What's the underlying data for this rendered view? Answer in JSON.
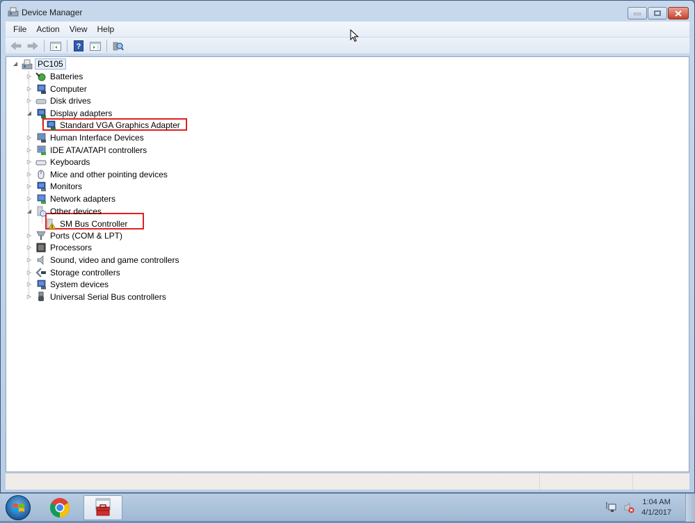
{
  "window": {
    "title": "Device Manager",
    "controls": [
      "minimize",
      "maximize",
      "close"
    ]
  },
  "menu": {
    "items": [
      {
        "label": "File"
      },
      {
        "label": "Action"
      },
      {
        "label": "View"
      },
      {
        "label": "Help"
      }
    ]
  },
  "toolbar": {
    "buttons": [
      {
        "icon": "back-arrow-icon",
        "enabled": false
      },
      {
        "icon": "forward-arrow-icon",
        "enabled": false
      },
      {
        "icon": "show-hide-console-tree-icon"
      },
      {
        "icon": "help-icon"
      },
      {
        "icon": "show-hide-action-pane-icon"
      },
      {
        "icon": "scan-hardware-changes-icon"
      }
    ]
  },
  "tree": {
    "root": {
      "label": "PC105",
      "expanded": true,
      "icon": "computer-icon"
    },
    "categories": [
      {
        "label": "Batteries",
        "expanded": false,
        "icon": "battery-icon"
      },
      {
        "label": "Computer",
        "expanded": false,
        "icon": "computer-icon"
      },
      {
        "label": "Disk drives",
        "expanded": false,
        "icon": "disk-drive-icon"
      },
      {
        "label": "Display adapters",
        "expanded": true,
        "icon": "display-adapter-icon",
        "children": [
          {
            "label": "Standard VGA Graphics Adapter",
            "icon": "display-adapter-icon",
            "highlighted": true
          }
        ]
      },
      {
        "label": "Human Interface Devices",
        "expanded": false,
        "icon": "hid-icon"
      },
      {
        "label": "IDE ATA/ATAPI controllers",
        "expanded": false,
        "icon": "ide-controller-icon"
      },
      {
        "label": "Keyboards",
        "expanded": false,
        "icon": "keyboard-icon"
      },
      {
        "label": "Mice and other pointing devices",
        "expanded": false,
        "icon": "mouse-icon"
      },
      {
        "label": "Monitors",
        "expanded": false,
        "icon": "monitor-icon"
      },
      {
        "label": "Network adapters",
        "expanded": false,
        "icon": "network-adapter-icon"
      },
      {
        "label": "Other devices",
        "expanded": true,
        "icon": "unknown-device-icon",
        "children": [
          {
            "label": "SM Bus Controller",
            "icon": "warning-device-icon",
            "highlighted": true
          }
        ]
      },
      {
        "label": "Ports (COM & LPT)",
        "expanded": false,
        "icon": "port-icon"
      },
      {
        "label": "Processors",
        "expanded": false,
        "icon": "processor-icon"
      },
      {
        "label": "Sound, video and game controllers",
        "expanded": false,
        "icon": "speaker-icon"
      },
      {
        "label": "Storage controllers",
        "expanded": false,
        "icon": "storage-controller-icon"
      },
      {
        "label": "System devices",
        "expanded": false,
        "icon": "system-device-icon"
      },
      {
        "label": "Universal Serial Bus controllers",
        "expanded": false,
        "icon": "usb-icon"
      }
    ]
  },
  "taskbar": {
    "apps": [
      {
        "name": "Google Chrome",
        "icon": "chrome-icon",
        "active": false
      },
      {
        "name": "Device Manager",
        "icon": "toolbox-icon",
        "active": true
      }
    ],
    "tray": {
      "icons": [
        "network-icon",
        "volume-muted-icon"
      ],
      "time": "1:04 AM",
      "date": "4/1/2017"
    }
  },
  "colors": {
    "highlight_box": "#e02020",
    "window_frame": "#c7d8ec",
    "taskbar": "#a9c0d9"
  }
}
